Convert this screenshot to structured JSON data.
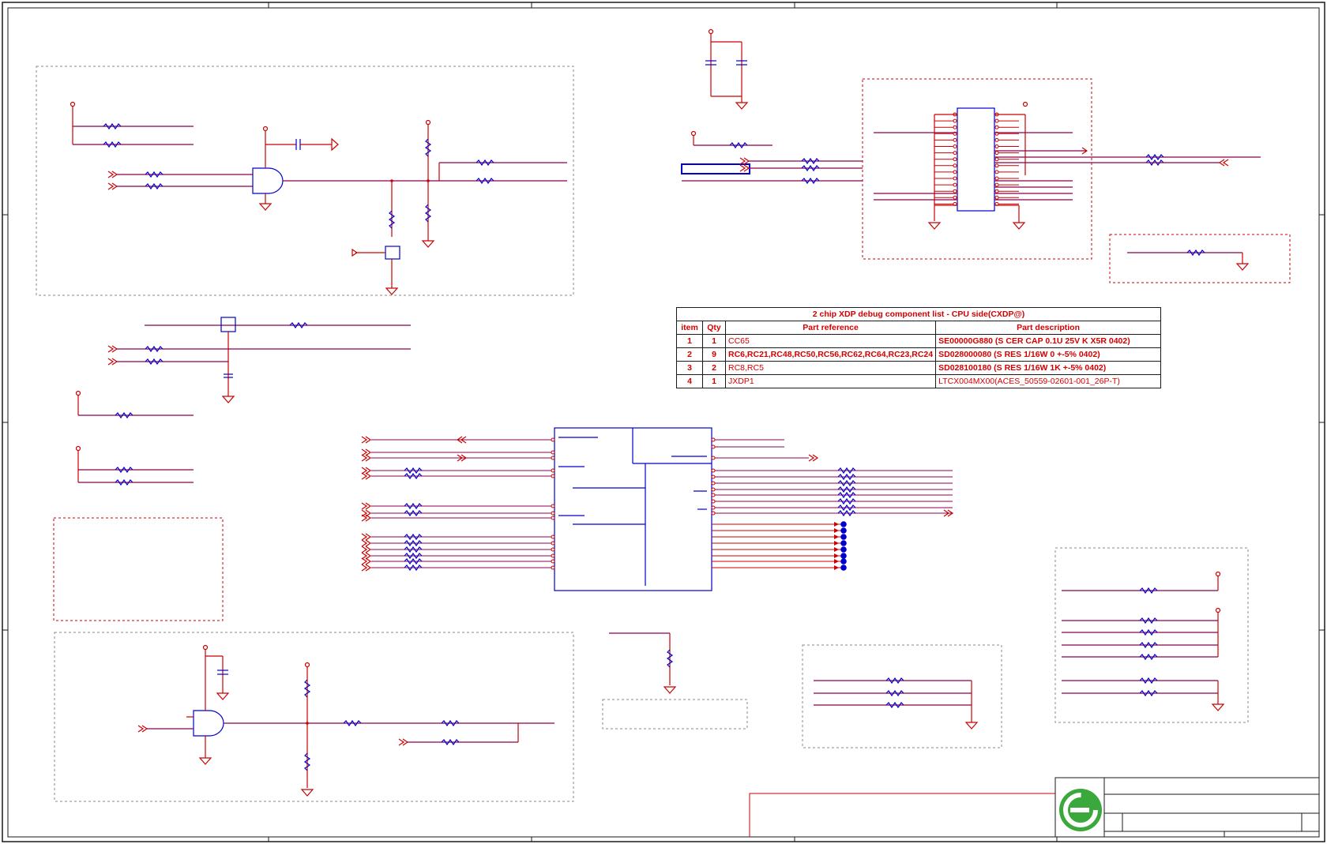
{
  "bom_table": {
    "title": "2 chip XDP debug component list - CPU side(CXDP@)",
    "headers": [
      "item",
      "Qty",
      "Part reference",
      "Part description"
    ],
    "rows": [
      {
        "item": "1",
        "qty": "1",
        "ref": "CC65",
        "desc": "SE00000G880 (S CER CAP 0.1U 25V K X5R 0402)"
      },
      {
        "item": "2",
        "qty": "9",
        "ref": "RC6,RC21,RC48,RC50,RC56,RC62,RC64,RC23,RC24",
        "desc": "SD028000080 (S RES 1/16W 0 +-5% 0402)"
      },
      {
        "item": "3",
        "qty": "2",
        "ref": "RC8,RC5",
        "desc": "SD028100180 (S RES 1/16W 1K +-5% 0402)"
      },
      {
        "item": "4",
        "qty": "1",
        "ref": "JXDP1",
        "desc": "LTCX004MX00(ACES_50559-02601-001_26P-T)"
      }
    ]
  },
  "colors": {
    "wire": "#cc0000",
    "net": "#8a0050",
    "component": "#0000cc",
    "border": "#1a1a1a",
    "dashed_box": "#888888",
    "logo_green": "#3aa83a"
  },
  "icons": {
    "logo": "company-logo-icon"
  }
}
